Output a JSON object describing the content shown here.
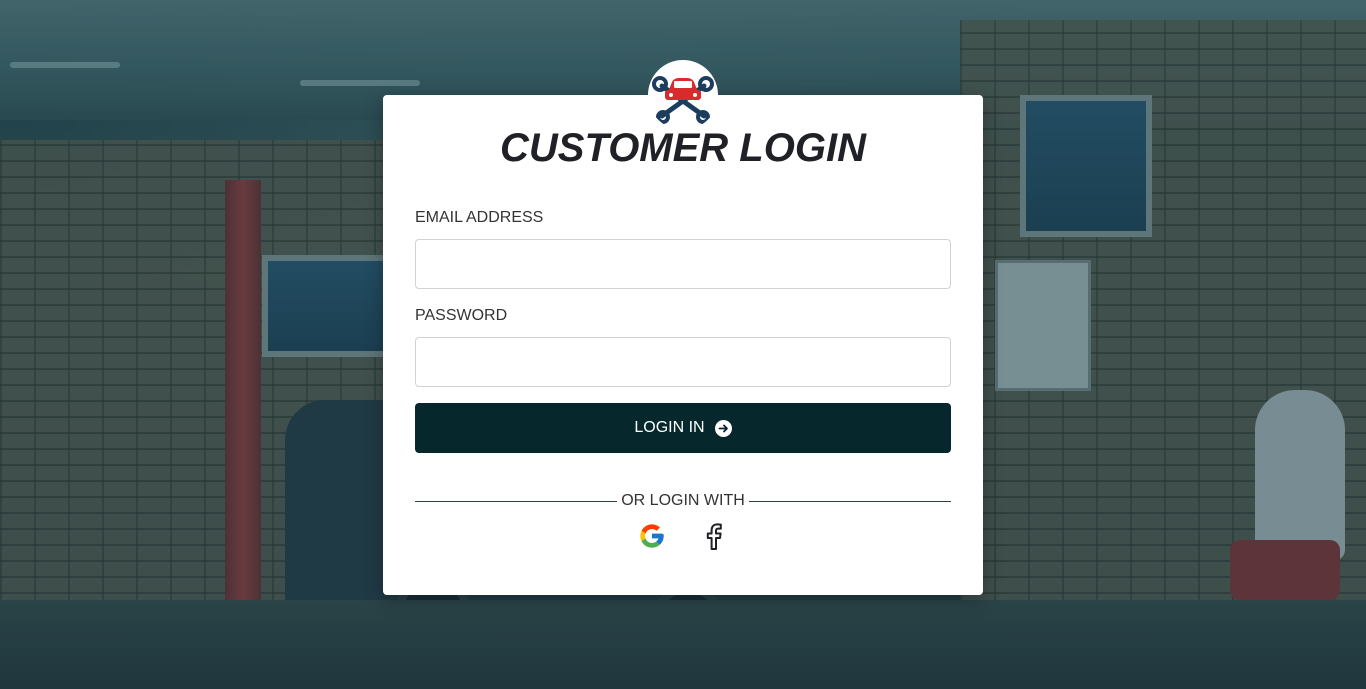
{
  "login": {
    "title": "CUSTOMER LOGIN",
    "email_label": "EMAIL ADDRESS",
    "email_value": "",
    "password_label": "PASSWORD",
    "password_value": "",
    "submit_label": "LOGIN IN",
    "divider_text": "OR LOGIN WITH",
    "social": [
      {
        "name": "Google",
        "icon": "google-icon"
      },
      {
        "name": "Facebook",
        "icon": "facebook-icon"
      }
    ]
  },
  "logo": {
    "icon": "car-wrench-logo-icon"
  },
  "colors": {
    "button": "#06282d",
    "overlay": "#143c46",
    "logo_car": "#d92b2b",
    "logo_wrench": "#1c3d5e"
  }
}
